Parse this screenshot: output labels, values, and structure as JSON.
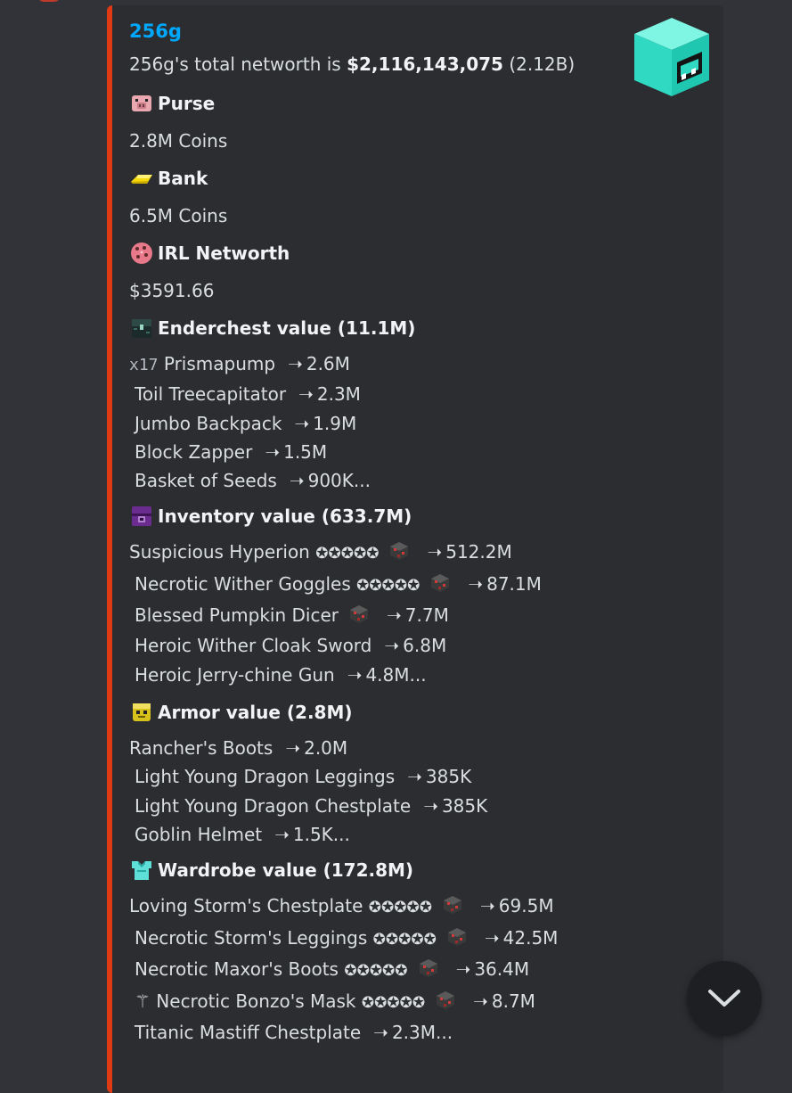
{
  "embed": {
    "author": "256g",
    "description_prefix": "256g's total networth is ",
    "networth_value": "$2,116,143,075",
    "networth_short": " (2.12B)",
    "accent_color": "#e03a14",
    "thumbnail_icon": "cyan-cube-avatar"
  },
  "fields": {
    "purse": {
      "title": "Purse",
      "value": "2.8M Coins",
      "icon": "pig-icon"
    },
    "bank": {
      "title": "Bank",
      "value": "6.5M Coins",
      "icon": "gold-bar-icon"
    },
    "irl": {
      "title": "IRL Networth",
      "value": "$3591.66",
      "icon": "cookie-icon"
    },
    "enderchest": {
      "title": "Enderchest value (11.1M)",
      "icon": "ender-chest-icon",
      "items": [
        {
          "qty": "x17",
          "name": "Prismapump",
          "value": "2.6M"
        },
        {
          "name": "Toil Treecapitator",
          "value": "2.3M"
        },
        {
          "name": "Jumbo Backpack",
          "value": "1.9M"
        },
        {
          "name": "Block Zapper",
          "value": "1.5M"
        },
        {
          "name": "Basket of Seeds",
          "value": "900K..."
        }
      ]
    },
    "inventory": {
      "title": "Inventory value (633.7M)",
      "icon": "shulker-icon",
      "items": [
        {
          "name": "Suspicious Hyperion",
          "stars": "✪✪✪✪✪",
          "gem": true,
          "value": "512.2M"
        },
        {
          "name": "Necrotic Wither Goggles",
          "stars": "✪✪✪✪✪",
          "gem": true,
          "value": "87.1M"
        },
        {
          "name": "Blessed Pumpkin Dicer",
          "gem": true,
          "value": "7.7M"
        },
        {
          "name": "Heroic Wither Cloak Sword",
          "value": "6.8M"
        },
        {
          "name": "Heroic Jerry-chine Gun",
          "value": "4.8M..."
        }
      ]
    },
    "armor": {
      "title": "Armor value (2.8M)",
      "icon": "armor-stand-icon",
      "items": [
        {
          "name": "Rancher's Boots",
          "value": "2.0M"
        },
        {
          "name": "Light Young Dragon Leggings",
          "value": "385K"
        },
        {
          "name": "Light Young Dragon Chestplate",
          "value": "385K"
        },
        {
          "name": "Goblin Helmet",
          "value": "1.5K..."
        }
      ]
    },
    "wardrobe": {
      "title": "Wardrobe value (172.8M)",
      "icon": "diamond-chestplate-icon",
      "items": [
        {
          "name": "Loving Storm's Chestplate",
          "stars": "✪✪✪✪✪",
          "gem": true,
          "value": "69.5M"
        },
        {
          "name": "Necrotic Storm's Leggings",
          "stars": "✪✪✪✪✪",
          "gem": true,
          "value": "42.5M"
        },
        {
          "name": "Necrotic Maxor's Boots",
          "stars": "✪✪✪✪✪",
          "gem": true,
          "value": "36.4M"
        },
        {
          "prefix": "⚚",
          "name": "Necrotic Bonzo's Mask",
          "stars": "✪✪✪✪✪",
          "gem": true,
          "value": "8.7M"
        },
        {
          "name": "Titanic Mastiff Chestplate",
          "value": "2.3M..."
        }
      ]
    }
  },
  "arrow_glyph": "➝",
  "scroll_button_icon": "chevron-down-icon"
}
